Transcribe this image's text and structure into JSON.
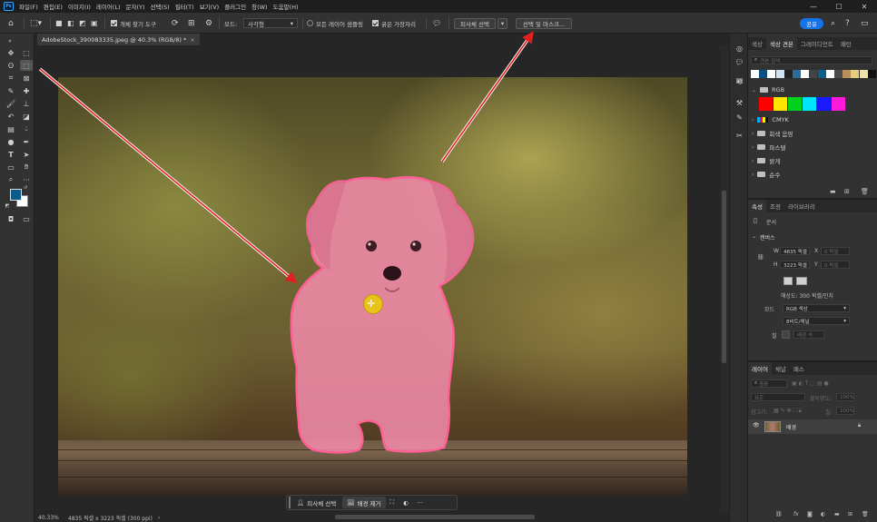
{
  "app": {
    "logo": "Ps"
  },
  "menu": [
    "파일(F)",
    "편집(E)",
    "이미지(I)",
    "레이어(L)",
    "문자(Y)",
    "선택(S)",
    "필터(T)",
    "보기(V)",
    "플러그인",
    "창(W)",
    "도움말(H)"
  ],
  "window_controls": {
    "minimize": "—",
    "maximize": "☐",
    "close": "✕"
  },
  "options_bar": {
    "object_finder_label": "개체 찾기 도구",
    "mode_label": "모드:",
    "mode_value": "사각형",
    "sample_all_label": "모든 레이어 샘플링",
    "hard_edge_label": "굵은 가장자리",
    "select_subject_label": "피사체 선택",
    "select_and_mask_label": "선택 및 마스크...",
    "share_label": "공유"
  },
  "document": {
    "tab_title": "AdobeStock_390083335.jpeg @ 40.3% (RGB/8) *",
    "zoom": "40.33%",
    "info": "4835 픽셀 x 3223 픽셀 (300 ppi)"
  },
  "context_bar": {
    "select_subject": "피사체 선택",
    "remove_bg": "배경 제거",
    "more": "···"
  },
  "swatches_panel": {
    "tabs": [
      "색상",
      "색상 견본",
      "그레이디언트",
      "패턴"
    ],
    "active_tab": 1,
    "search_placeholder": "견본 검색",
    "recent_colors": [
      "#ffffff",
      "#0d4f7e",
      "#ffffff",
      "#cfe3f2",
      "#222222",
      "#2a6f9c",
      "#ffffff",
      "#444444",
      "#0b5f8a",
      "#ffffff",
      "#4a4a4a",
      "#b98f5a",
      "#e3cf7a",
      "#f1e2a7",
      "#111111"
    ],
    "groups": [
      {
        "name": "RGB",
        "open": true,
        "colors": [
          "#ff0000",
          "#ffe600",
          "#00d21e",
          "#00e5ff",
          "#1a1aff",
          "#ff1ad9"
        ]
      },
      {
        "name": "CMYK",
        "open": false,
        "colors": [
          "#00aeef",
          "#ec008c",
          "#fff200",
          "#111111"
        ]
      },
      {
        "name": "회색 음영",
        "open": false
      },
      {
        "name": "파스텔",
        "open": false
      },
      {
        "name": "밝게",
        "open": false
      },
      {
        "name": "순수",
        "open": false
      }
    ]
  },
  "properties_panel": {
    "tabs": [
      "속성",
      "조정",
      "라이브러리"
    ],
    "doc_label": "문서",
    "canvas_label": "캔버스",
    "w_label": "W",
    "w_value": "4835 픽셀",
    "h_label": "H",
    "h_value": "3223 픽셀",
    "x_label": "X",
    "x_placeholder": "0 픽셀",
    "y_label": "Y",
    "y_placeholder": "0 픽셀",
    "resolution": "해상도: 300 픽셀/인치",
    "mode_label": "모드",
    "mode_value": "RGB 색상",
    "depth_value": "8비트/채널",
    "fill_label": "칠",
    "fill_value": "배경 색"
  },
  "layers_panel": {
    "tabs": [
      "레이어",
      "채널",
      "패스"
    ],
    "filter_label": "종류",
    "blend_mode": "표준",
    "opacity_label": "불투명도:",
    "opacity_value": "100%",
    "lock_label": "잠그기:",
    "fill_label": "칠:",
    "fill_value": "100%",
    "layers": [
      {
        "name": "배경",
        "visible": true,
        "locked": true
      }
    ]
  },
  "colors": {
    "accent": "#1473e6",
    "foreground": "#0d5b8a",
    "background": "#ffffff",
    "selection_overlay": "#ff6fa0",
    "arrow": "#e02020"
  },
  "icons": [
    "home-icon",
    "move-icon",
    "marquee-icon",
    "lasso-icon",
    "object-select-icon",
    "crop-icon",
    "frame-icon",
    "eyedropper-icon",
    "healing-icon",
    "brush-icon",
    "stamp-icon",
    "history-brush-icon",
    "eraser-icon",
    "gradient-icon",
    "blur-icon",
    "dodge-icon",
    "pen-icon",
    "type-icon",
    "path-select-icon",
    "shape-icon",
    "hand-icon",
    "zoom-icon",
    "more-tools-icon",
    "search-icon",
    "settings-icon",
    "help-icon",
    "eye-icon",
    "lock-icon",
    "folder-icon",
    "trash-icon"
  ]
}
